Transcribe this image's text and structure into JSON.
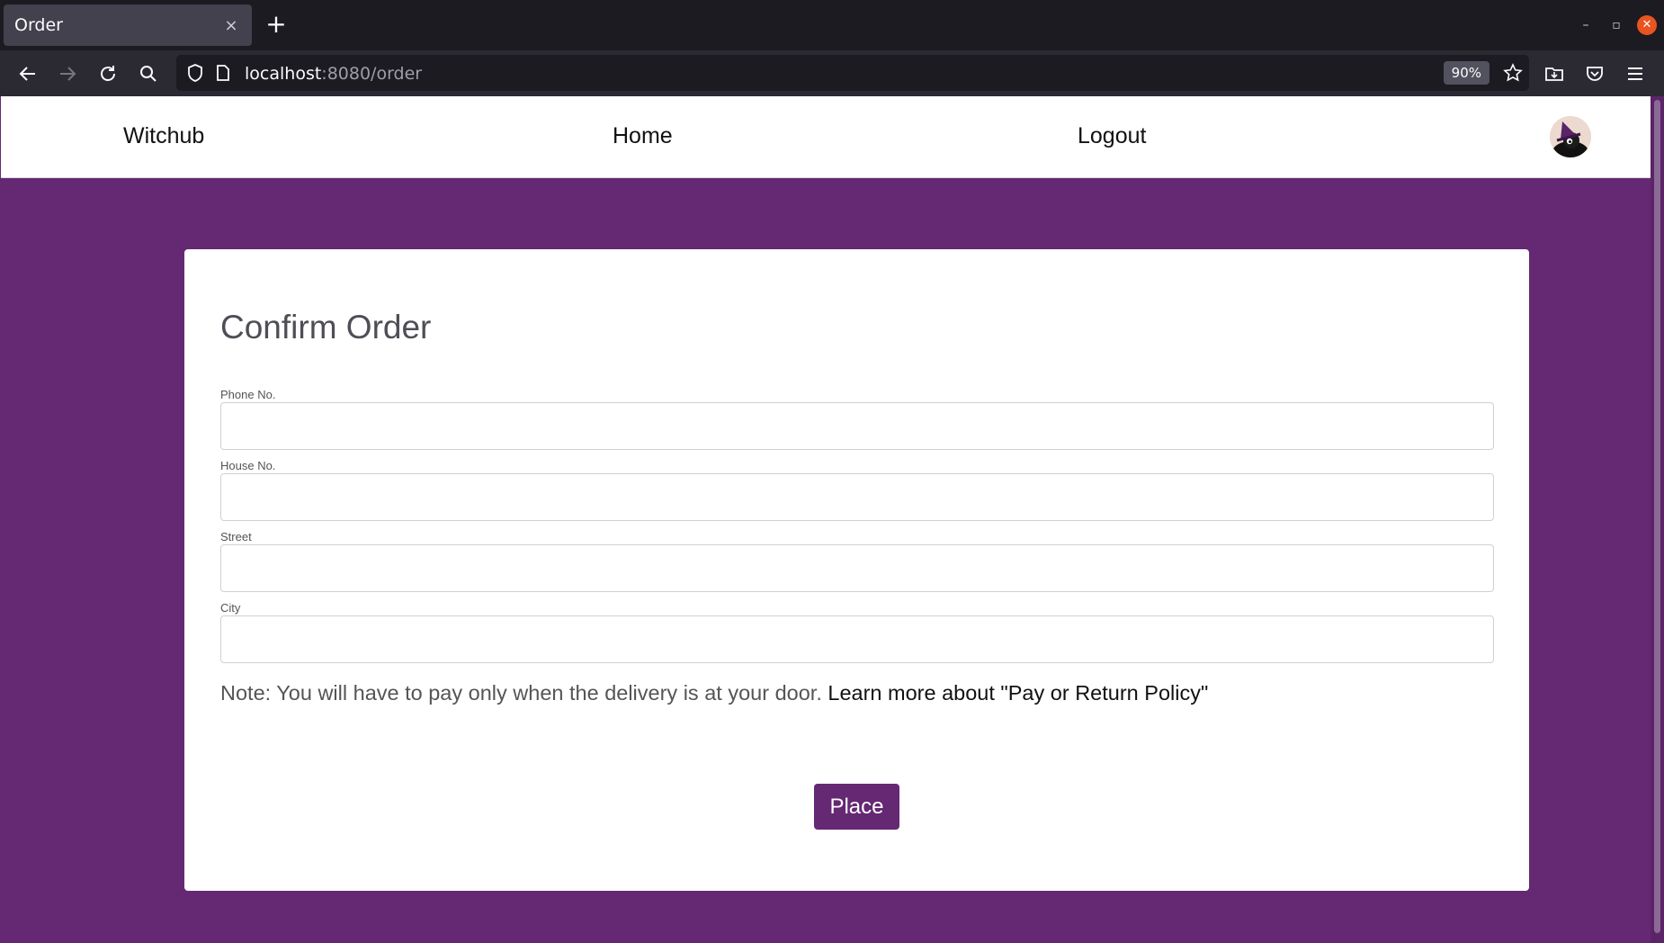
{
  "browser": {
    "tab_title": "Order",
    "tab_close": "×",
    "new_tab": "+",
    "url_host": "localhost",
    "url_path": ":8080/order",
    "zoom": "90%",
    "window_controls": {
      "minimize": "–",
      "restore": "▫",
      "close": "✕"
    }
  },
  "header": {
    "brand": "Witchub",
    "nav": [
      {
        "label": "Home"
      },
      {
        "label": "Logout"
      }
    ]
  },
  "form": {
    "title": "Confirm Order",
    "fields": [
      {
        "label": "Phone No.",
        "value": ""
      },
      {
        "label": "House No.",
        "value": ""
      },
      {
        "label": "Street",
        "value": ""
      },
      {
        "label": "City",
        "value": ""
      }
    ],
    "note_text": "Note: You will have to pay only when the delivery is at your door.",
    "note_link": "Learn more about \"Pay or Return Policy\"",
    "submit_label": "Place"
  },
  "colors": {
    "brand_purple": "#652873",
    "chrome_dark": "#1c1b22",
    "chrome_mid": "#2b2a33"
  },
  "icons": [
    "back-icon",
    "forward-icon",
    "reload-icon",
    "search-icon",
    "shield-icon",
    "page-icon",
    "bookmark-star-icon",
    "save-to-folder-icon",
    "pocket-icon",
    "menu-icon",
    "avatar-witch-icon"
  ]
}
